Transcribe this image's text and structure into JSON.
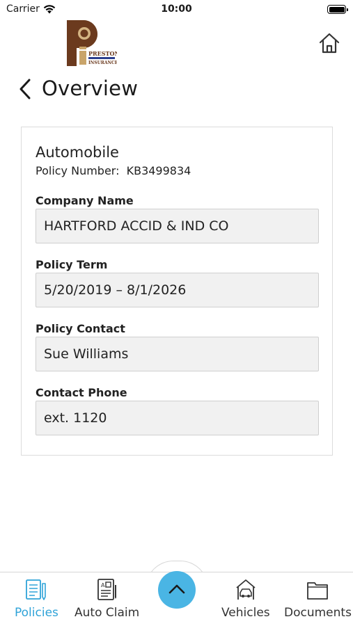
{
  "status_bar": {
    "carrier": "Carrier",
    "time": "10:00"
  },
  "logo": {
    "line1": "PRESTON",
    "line2": "INSURANCE"
  },
  "header": {
    "title": "Overview"
  },
  "policy": {
    "type": "Automobile",
    "number_label": "Policy Number:",
    "number": "KB3499834",
    "fields": [
      {
        "label": "Company Name",
        "value": "HARTFORD ACCID & IND CO"
      },
      {
        "label": "Policy Term",
        "value": "5/20/2019 – 8/1/2026"
      },
      {
        "label": "Policy Contact",
        "value": "Sue Williams"
      },
      {
        "label": "Contact Phone",
        "value": "ext. 1120"
      }
    ]
  },
  "tabs": [
    {
      "label": "Policies",
      "icon": "policies-icon",
      "active": true
    },
    {
      "label": "Auto Claim",
      "icon": "auto-claim-icon",
      "active": false
    },
    {
      "label": "Vehicles",
      "icon": "vehicles-icon",
      "active": false
    },
    {
      "label": "Documents",
      "icon": "documents-icon",
      "active": false
    }
  ],
  "colors": {
    "accent": "#2fa3d8",
    "fab": "#4ab5e4",
    "logo_brown": "#6b3a1e",
    "logo_tan": "#c9a46a",
    "logo_blue": "#2b3f8f"
  }
}
